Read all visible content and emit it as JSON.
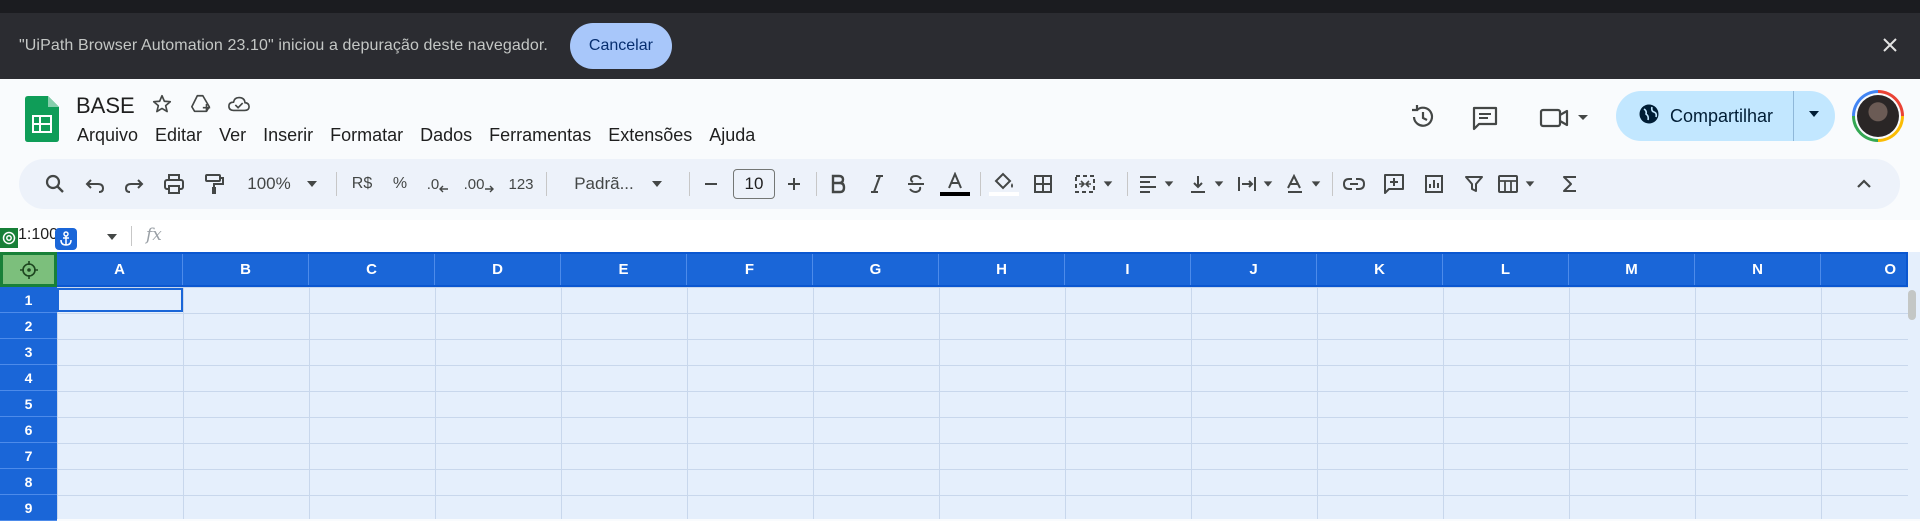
{
  "infobar": {
    "message": "\"UiPath Browser Automation 23.10\" iniciou a depuração deste navegador.",
    "cancel_label": "Cancelar"
  },
  "header": {
    "doc_title": "BASE",
    "menu": [
      "Arquivo",
      "Editar",
      "Ver",
      "Inserir",
      "Formatar",
      "Dados",
      "Ferramentas",
      "Extensões",
      "Ajuda"
    ],
    "share_label": "Compartilhar"
  },
  "toolbar": {
    "zoom": "100%",
    "currency": "R$",
    "percent": "%",
    "decrease_decimal": ".0",
    "increase_decimal": ".00",
    "number_format": "123",
    "font": "Padrã...",
    "font_size": "10"
  },
  "formula_bar": {
    "name_box": "1:100",
    "fx": "fx"
  },
  "grid": {
    "columns": [
      "A",
      "B",
      "C",
      "D",
      "E",
      "F",
      "G",
      "H",
      "I",
      "J",
      "K",
      "L",
      "M",
      "N",
      "O"
    ],
    "rows": [
      "1",
      "2",
      "3",
      "4",
      "5",
      "6",
      "7",
      "8",
      "9"
    ]
  },
  "colors": {
    "accent": "#1a66d8",
    "share_bg": "#c2e7ff",
    "cancel_bg": "#a8c7fa",
    "infobar_bg": "#2b2c31",
    "sheet_green": "#188038"
  }
}
